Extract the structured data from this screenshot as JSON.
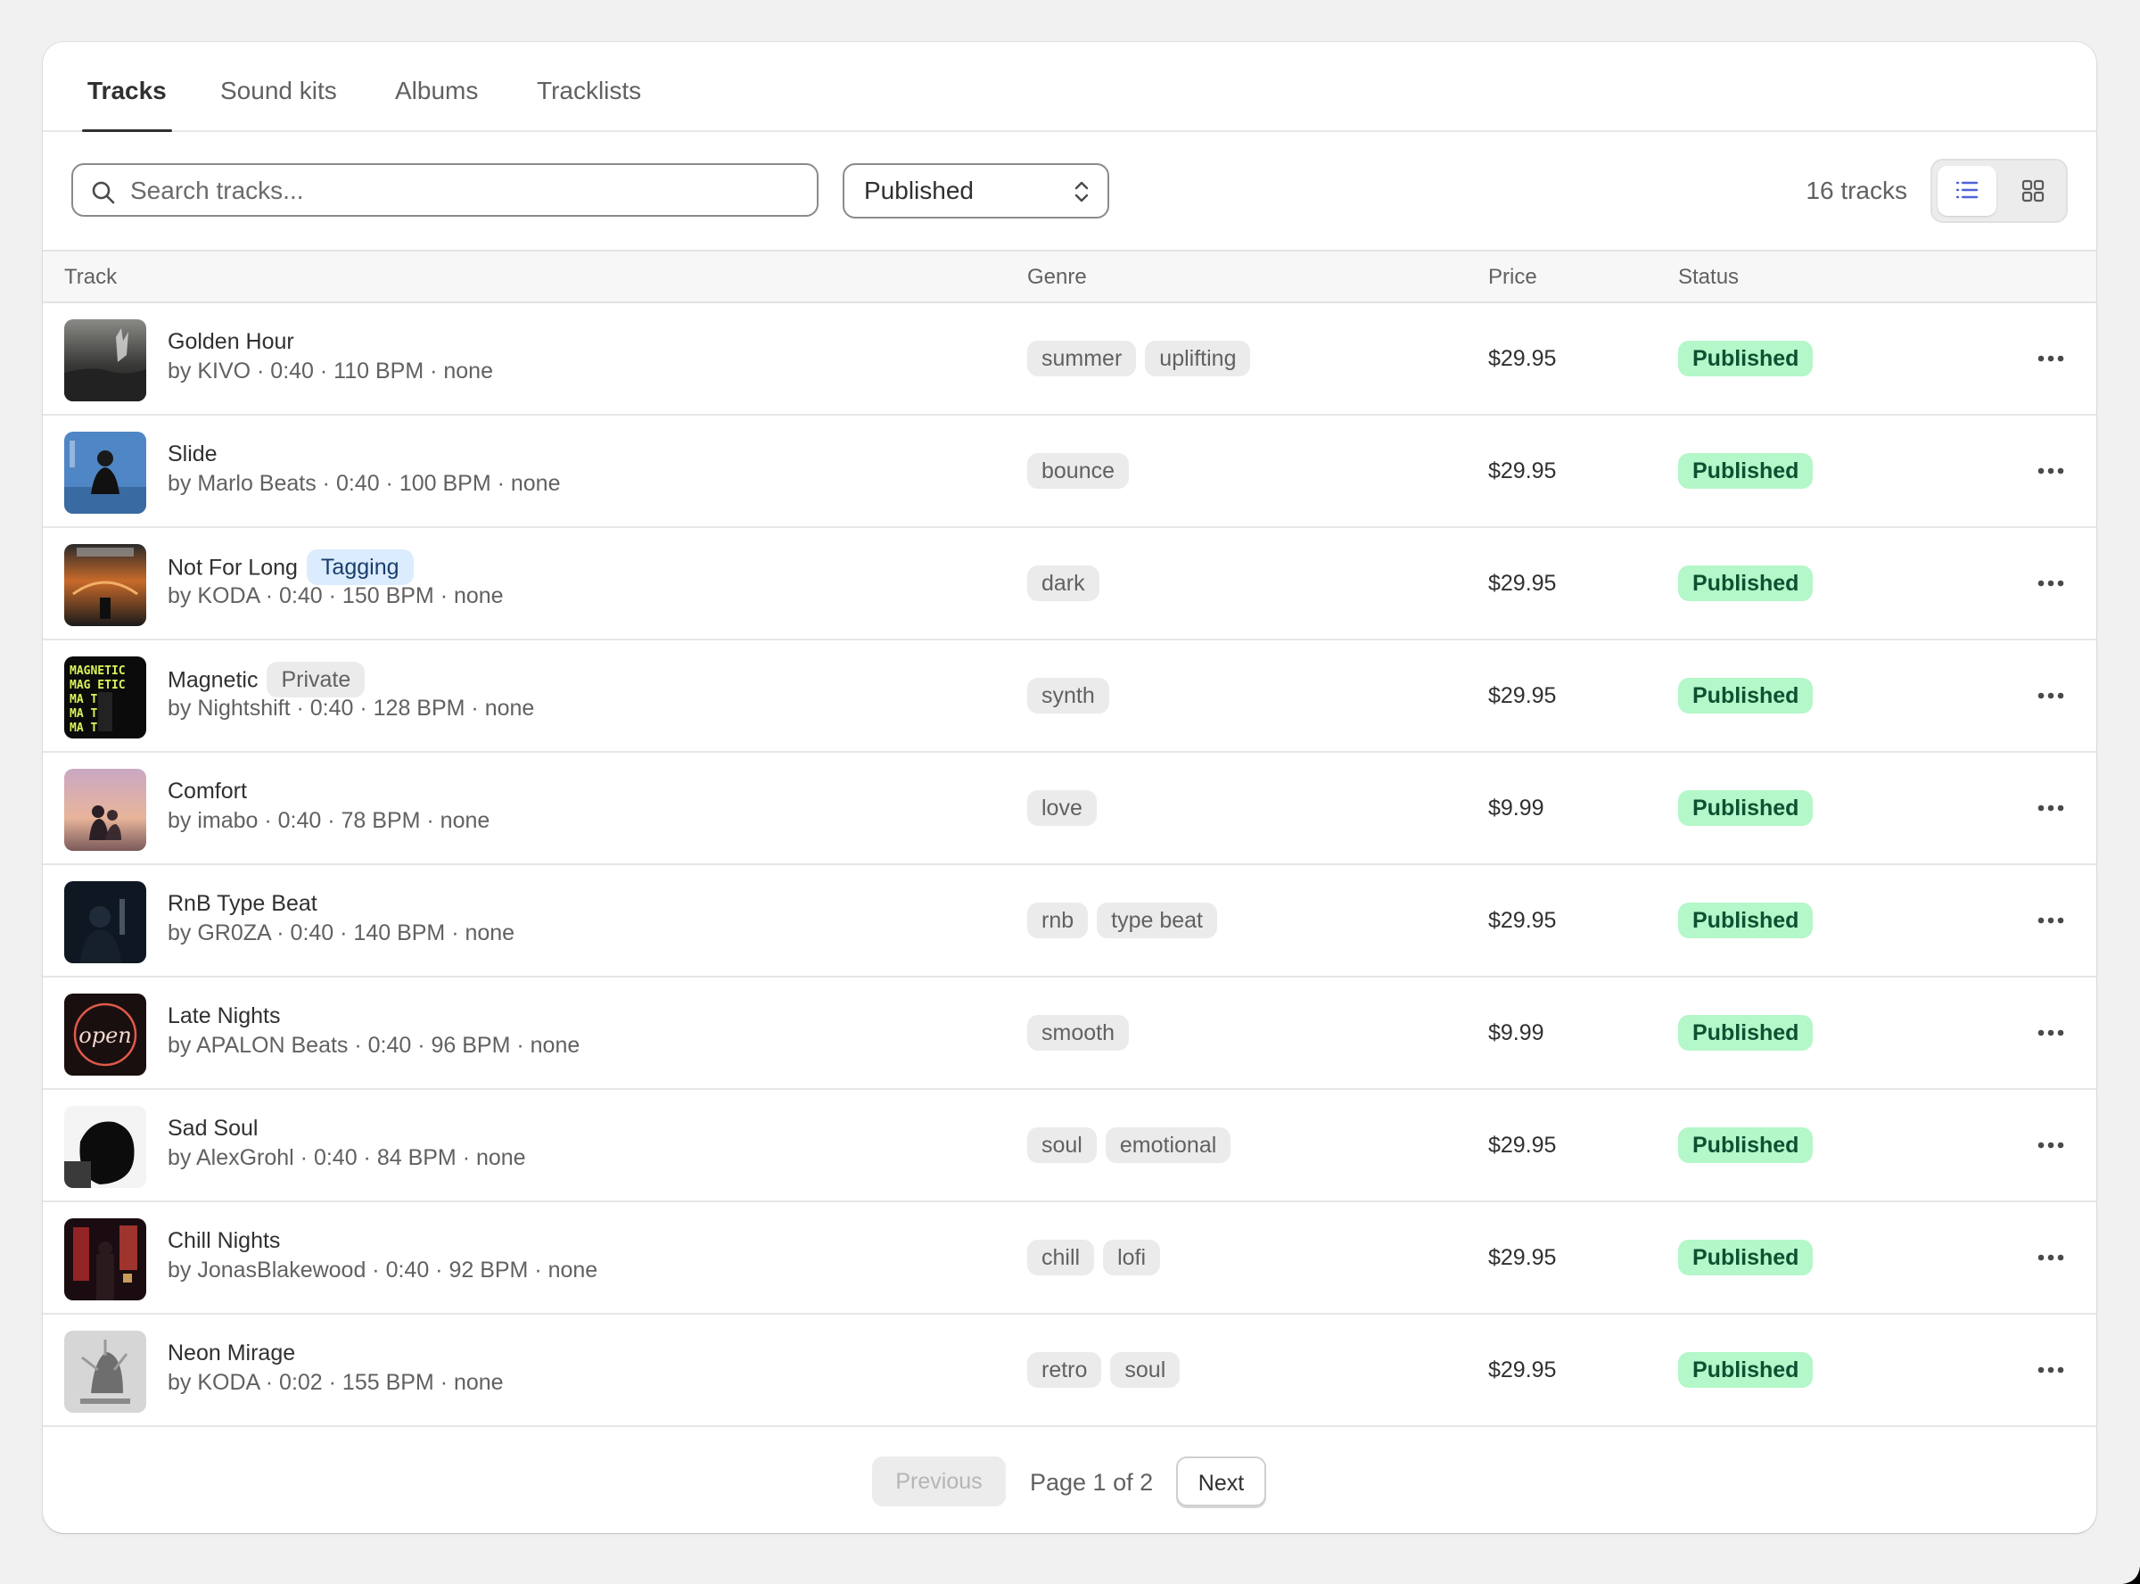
{
  "tabs": [
    {
      "label": "Tracks",
      "active": true
    },
    {
      "label": "Sound kits",
      "active": false
    },
    {
      "label": "Albums",
      "active": false
    },
    {
      "label": "Tracklists",
      "active": false
    }
  ],
  "search": {
    "placeholder": "Search tracks..."
  },
  "filter": {
    "selected": "Published"
  },
  "count": "16 tracks",
  "view": {
    "selected": "list",
    "icons": [
      "list-icon",
      "grid-icon"
    ]
  },
  "columns": {
    "track": "Track",
    "genre": "Genre",
    "price": "Price",
    "status": "Status"
  },
  "tracks": [
    {
      "title": "Golden Hour",
      "meta": "by KIVO · 0:40 · 110 BPM · none",
      "badge": null,
      "genres": [
        "summer",
        "uplifting"
      ],
      "price": "$29.95",
      "status": "Published"
    },
    {
      "title": "Slide",
      "meta": "by Marlo Beats · 0:40 · 100 BPM · none",
      "badge": null,
      "genres": [
        "bounce"
      ],
      "price": "$29.95",
      "status": "Published"
    },
    {
      "title": "Not For Long",
      "meta": "by KODA · 0:40 · 150 BPM · none",
      "badge": "Tagging",
      "genres": [
        "dark"
      ],
      "price": "$29.95",
      "status": "Published"
    },
    {
      "title": "Magnetic",
      "meta": "by Nightshift · 0:40 · 128 BPM · none",
      "badge": "Private",
      "genres": [
        "synth"
      ],
      "price": "$29.95",
      "status": "Published"
    },
    {
      "title": "Comfort",
      "meta": "by imabo · 0:40 · 78 BPM · none",
      "badge": null,
      "genres": [
        "love"
      ],
      "price": "$9.99",
      "status": "Published"
    },
    {
      "title": "RnB Type Beat",
      "meta": "by GR0ZA · 0:40 · 140 BPM · none",
      "badge": null,
      "genres": [
        "rnb",
        "type beat"
      ],
      "price": "$29.95",
      "status": "Published"
    },
    {
      "title": "Late Nights",
      "meta": "by APALON Beats · 0:40 · 96 BPM · none",
      "badge": null,
      "genres": [
        "smooth"
      ],
      "price": "$9.99",
      "status": "Published"
    },
    {
      "title": "Sad Soul",
      "meta": "by AlexGrohl · 0:40 · 84 BPM · none",
      "badge": null,
      "genres": [
        "soul",
        "emotional"
      ],
      "price": "$29.95",
      "status": "Published"
    },
    {
      "title": "Chill Nights",
      "meta": "by JonasBlakewood · 0:40 · 92 BPM · none",
      "badge": null,
      "genres": [
        "chill",
        "lofi"
      ],
      "price": "$29.95",
      "status": "Published"
    },
    {
      "title": "Neon Mirage",
      "meta": "by KODA · 0:02 · 155 BPM · none",
      "badge": null,
      "genres": [
        "retro",
        "soul"
      ],
      "price": "$29.95",
      "status": "Published"
    }
  ],
  "pagination": {
    "previous": "Previous",
    "info": "Page 1 of 2",
    "next": "Next"
  },
  "colors": {
    "status_bg": "#b4f7c8",
    "status_fg": "#0c5132",
    "tagging_bg": "#dbecff",
    "accent": "#4f62d8"
  }
}
